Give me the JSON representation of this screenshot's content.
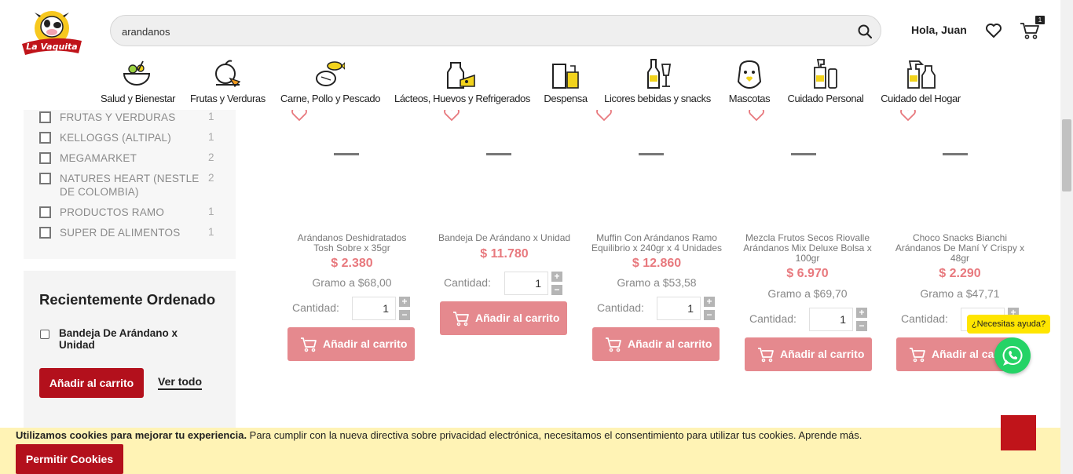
{
  "header": {
    "logo_text": "La Vaquita",
    "search_value": "arandanos",
    "greeting": "Hola, Juan",
    "cart_count": "1"
  },
  "categories": [
    {
      "label": "Salud y Bienestar",
      "icon": "salad-bowl-icon"
    },
    {
      "label": "Frutas y Verduras",
      "icon": "fruit-basket-icon"
    },
    {
      "label": "Carne, Pollo y Pescado",
      "icon": "meat-fish-icon"
    },
    {
      "label": "Lácteos, Huevos y Refrigerados",
      "icon": "milk-cheese-icon"
    },
    {
      "label": "Despensa",
      "icon": "pantry-icon"
    },
    {
      "label": "Licores bebidas y snacks",
      "icon": "bottle-glass-icon"
    },
    {
      "label": "Mascotas",
      "icon": "pet-icon"
    },
    {
      "label": "Cuidado Personal",
      "icon": "personal-care-icon"
    },
    {
      "label": "Cuidado del Hogar",
      "icon": "cleaning-spray-icon"
    }
  ],
  "filters": [
    {
      "label": "FRUTAS Y VERDURAS",
      "count": "1"
    },
    {
      "label": "KELLOGGS (ALTIPAL)",
      "count": "1"
    },
    {
      "label": "MEGAMARKET",
      "count": "2"
    },
    {
      "label": "NATURES HEART (NESTLE DE COLOMBIA)",
      "count": "2"
    },
    {
      "label": "PRODUCTOS RAMO",
      "count": "1"
    },
    {
      "label": "SUPER DE ALIMENTOS",
      "count": "1"
    }
  ],
  "recent": {
    "title": "Recientemente Ordenado",
    "item": "Bandeja De Arándano x Unidad",
    "add_label": "Añadir al carrito",
    "view_all": "Ver todo"
  },
  "products": [
    {
      "name": "Arándanos Deshidratados Tosh Sobre x 35gr",
      "price": "$ 2.380",
      "unit_price": "Gramo a $68,00",
      "qty_label": "Cantidad:",
      "qty": "1",
      "add_label": "Añadir al carrito"
    },
    {
      "name": "Bandeja De Arándano x Unidad",
      "price": "$ 11.780",
      "unit_price": "",
      "qty_label": "Cantidad:",
      "qty": "1",
      "add_label": "Añadir al carrito"
    },
    {
      "name": "Muffin Con Arándanos Ramo Equilibrio x 240gr x 4 Unidades",
      "price": "$ 12.860",
      "unit_price": "Gramo a $53,58",
      "qty_label": "Cantidad:",
      "qty": "1",
      "add_label": "Añadir al carrito"
    },
    {
      "name": "Mezcla Frutos Secos Riovalle Arándanos Mix Deluxe Bolsa x 100gr",
      "price": "$ 6.970",
      "unit_price": "Gramo a $69,70",
      "qty_label": "Cantidad:",
      "qty": "1",
      "add_label": "Añadir al carrito"
    },
    {
      "name": "Choco Snacks Bianchi Arándanos De Maní Y Crispy x 48gr",
      "price": "$ 2.290",
      "unit_price": "Gramo a $47,71",
      "qty_label": "Cantidad:",
      "qty": "1",
      "add_label": "Añadir al car"
    }
  ],
  "whatsapp": {
    "bubble": "¿Necesitas ayuda?"
  },
  "cookie": {
    "bold": "Utilizamos cookies para mejorar tu experiencia.",
    "text": " Para cumplir con la nueva directiva sobre privacidad electrónica, necesitamos el consentimiento para utilizar tus cookies. Aprende más.",
    "button": "Permitir Cookies"
  },
  "colors": {
    "brand_red": "#b3101c",
    "button_pink": "#e5898e",
    "price_pink": "#e8797e",
    "cookie_bg": "#fff3b5",
    "whatsapp": "#25d366"
  }
}
